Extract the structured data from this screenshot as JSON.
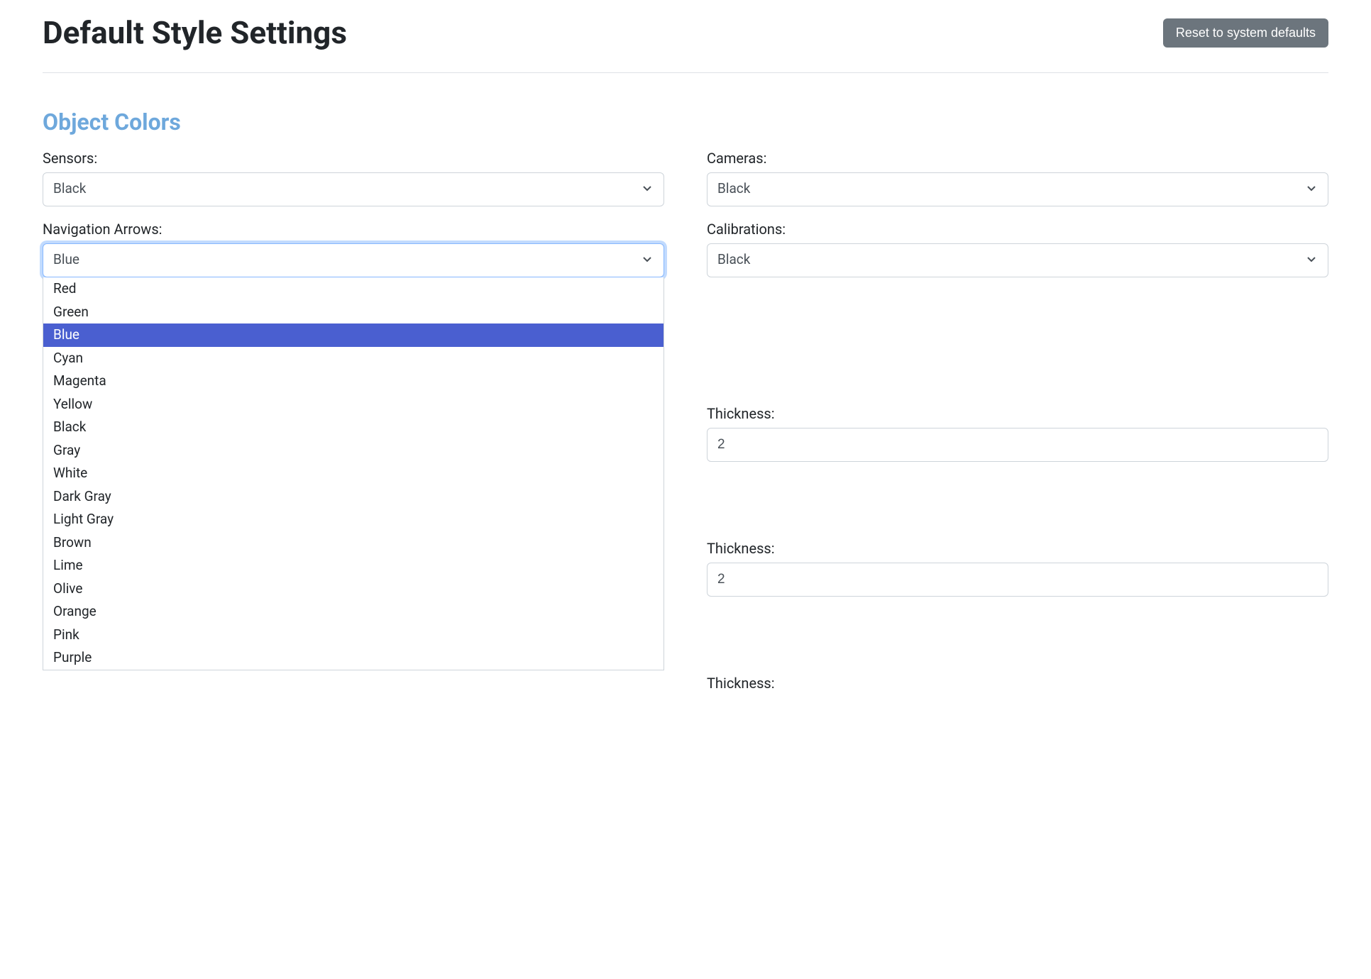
{
  "header": {
    "title": "Default Style Settings",
    "reset_label": "Reset to system defaults"
  },
  "section_object_colors": {
    "title": "Object Colors"
  },
  "fields": {
    "sensors": {
      "label": "Sensors:",
      "value": "Black"
    },
    "cameras": {
      "label": "Cameras:",
      "value": "Black"
    },
    "navigation_arrows": {
      "label": "Navigation Arrows:",
      "value": "Blue"
    },
    "calibrations": {
      "label": "Calibrations:",
      "value": "Black"
    },
    "thickness1": {
      "label": "Thickness:",
      "value": "2"
    },
    "thickness2": {
      "label": "Thickness:",
      "value": "2"
    },
    "thickness3": {
      "label": "Thickness:"
    }
  },
  "color_options": [
    "Red",
    "Green",
    "Blue",
    "Cyan",
    "Magenta",
    "Yellow",
    "Black",
    "Gray",
    "White",
    "Dark Gray",
    "Light Gray",
    "Brown",
    "Lime",
    "Olive",
    "Orange",
    "Pink",
    "Purple"
  ],
  "selected_color_option": "Blue"
}
